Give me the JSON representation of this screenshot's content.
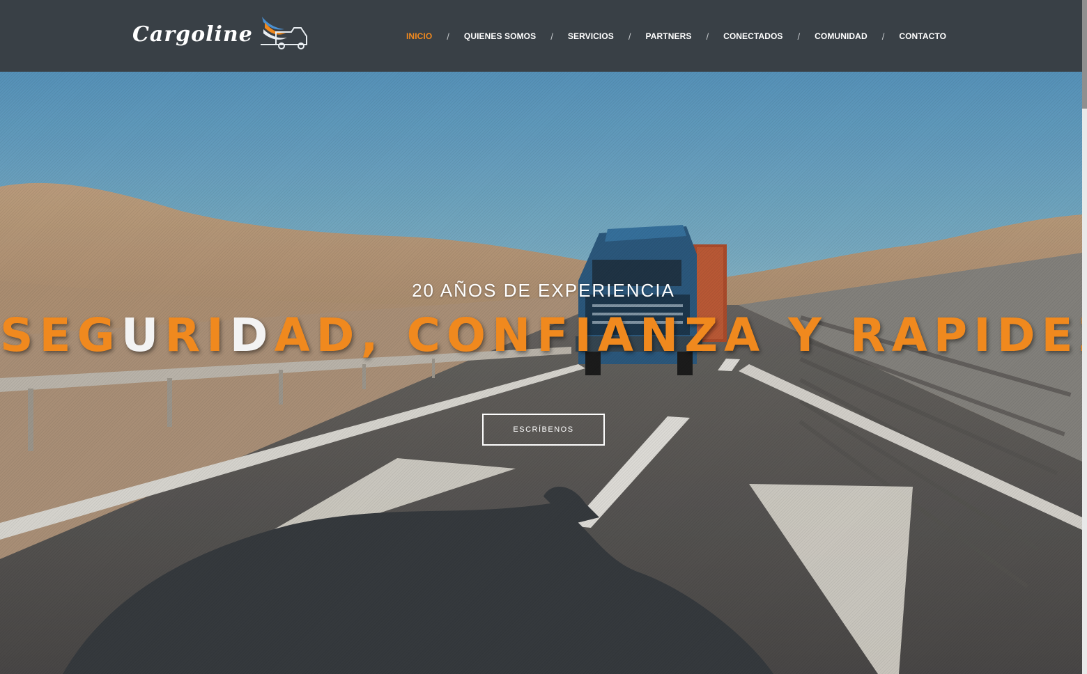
{
  "brand": {
    "logo_text": "Cargoline",
    "logo_icon": "truck-wings-icon"
  },
  "nav": {
    "items": [
      {
        "label": "INICIO",
        "active": true
      },
      {
        "label": "QUIENES SOMOS",
        "active": false
      },
      {
        "label": "SERVICIOS",
        "active": false
      },
      {
        "label": "PARTNERS",
        "active": false
      },
      {
        "label": "CONECTADOS",
        "active": false
      },
      {
        "label": "COMUNIDAD",
        "active": false
      },
      {
        "label": "CONTACTO",
        "active": false
      }
    ],
    "separator": "/"
  },
  "hero": {
    "subtitle": "20 AÑOS DE EXPERIENCIA",
    "title_parts": [
      {
        "text": "SEG",
        "highlight": false
      },
      {
        "text": "U",
        "highlight": true
      },
      {
        "text": "RI",
        "highlight": false
      },
      {
        "text": "D",
        "highlight": true
      },
      {
        "text": "AD, CONFIANZA Y RAPIDEZ",
        "highlight": false
      }
    ],
    "cta_label": "ESCRÍBENOS",
    "background_scene": "truck-on-desert-highway"
  },
  "colors": {
    "header_bg": "#394046",
    "accent_orange": "#f0891e",
    "nav_text": "#ffffff"
  }
}
